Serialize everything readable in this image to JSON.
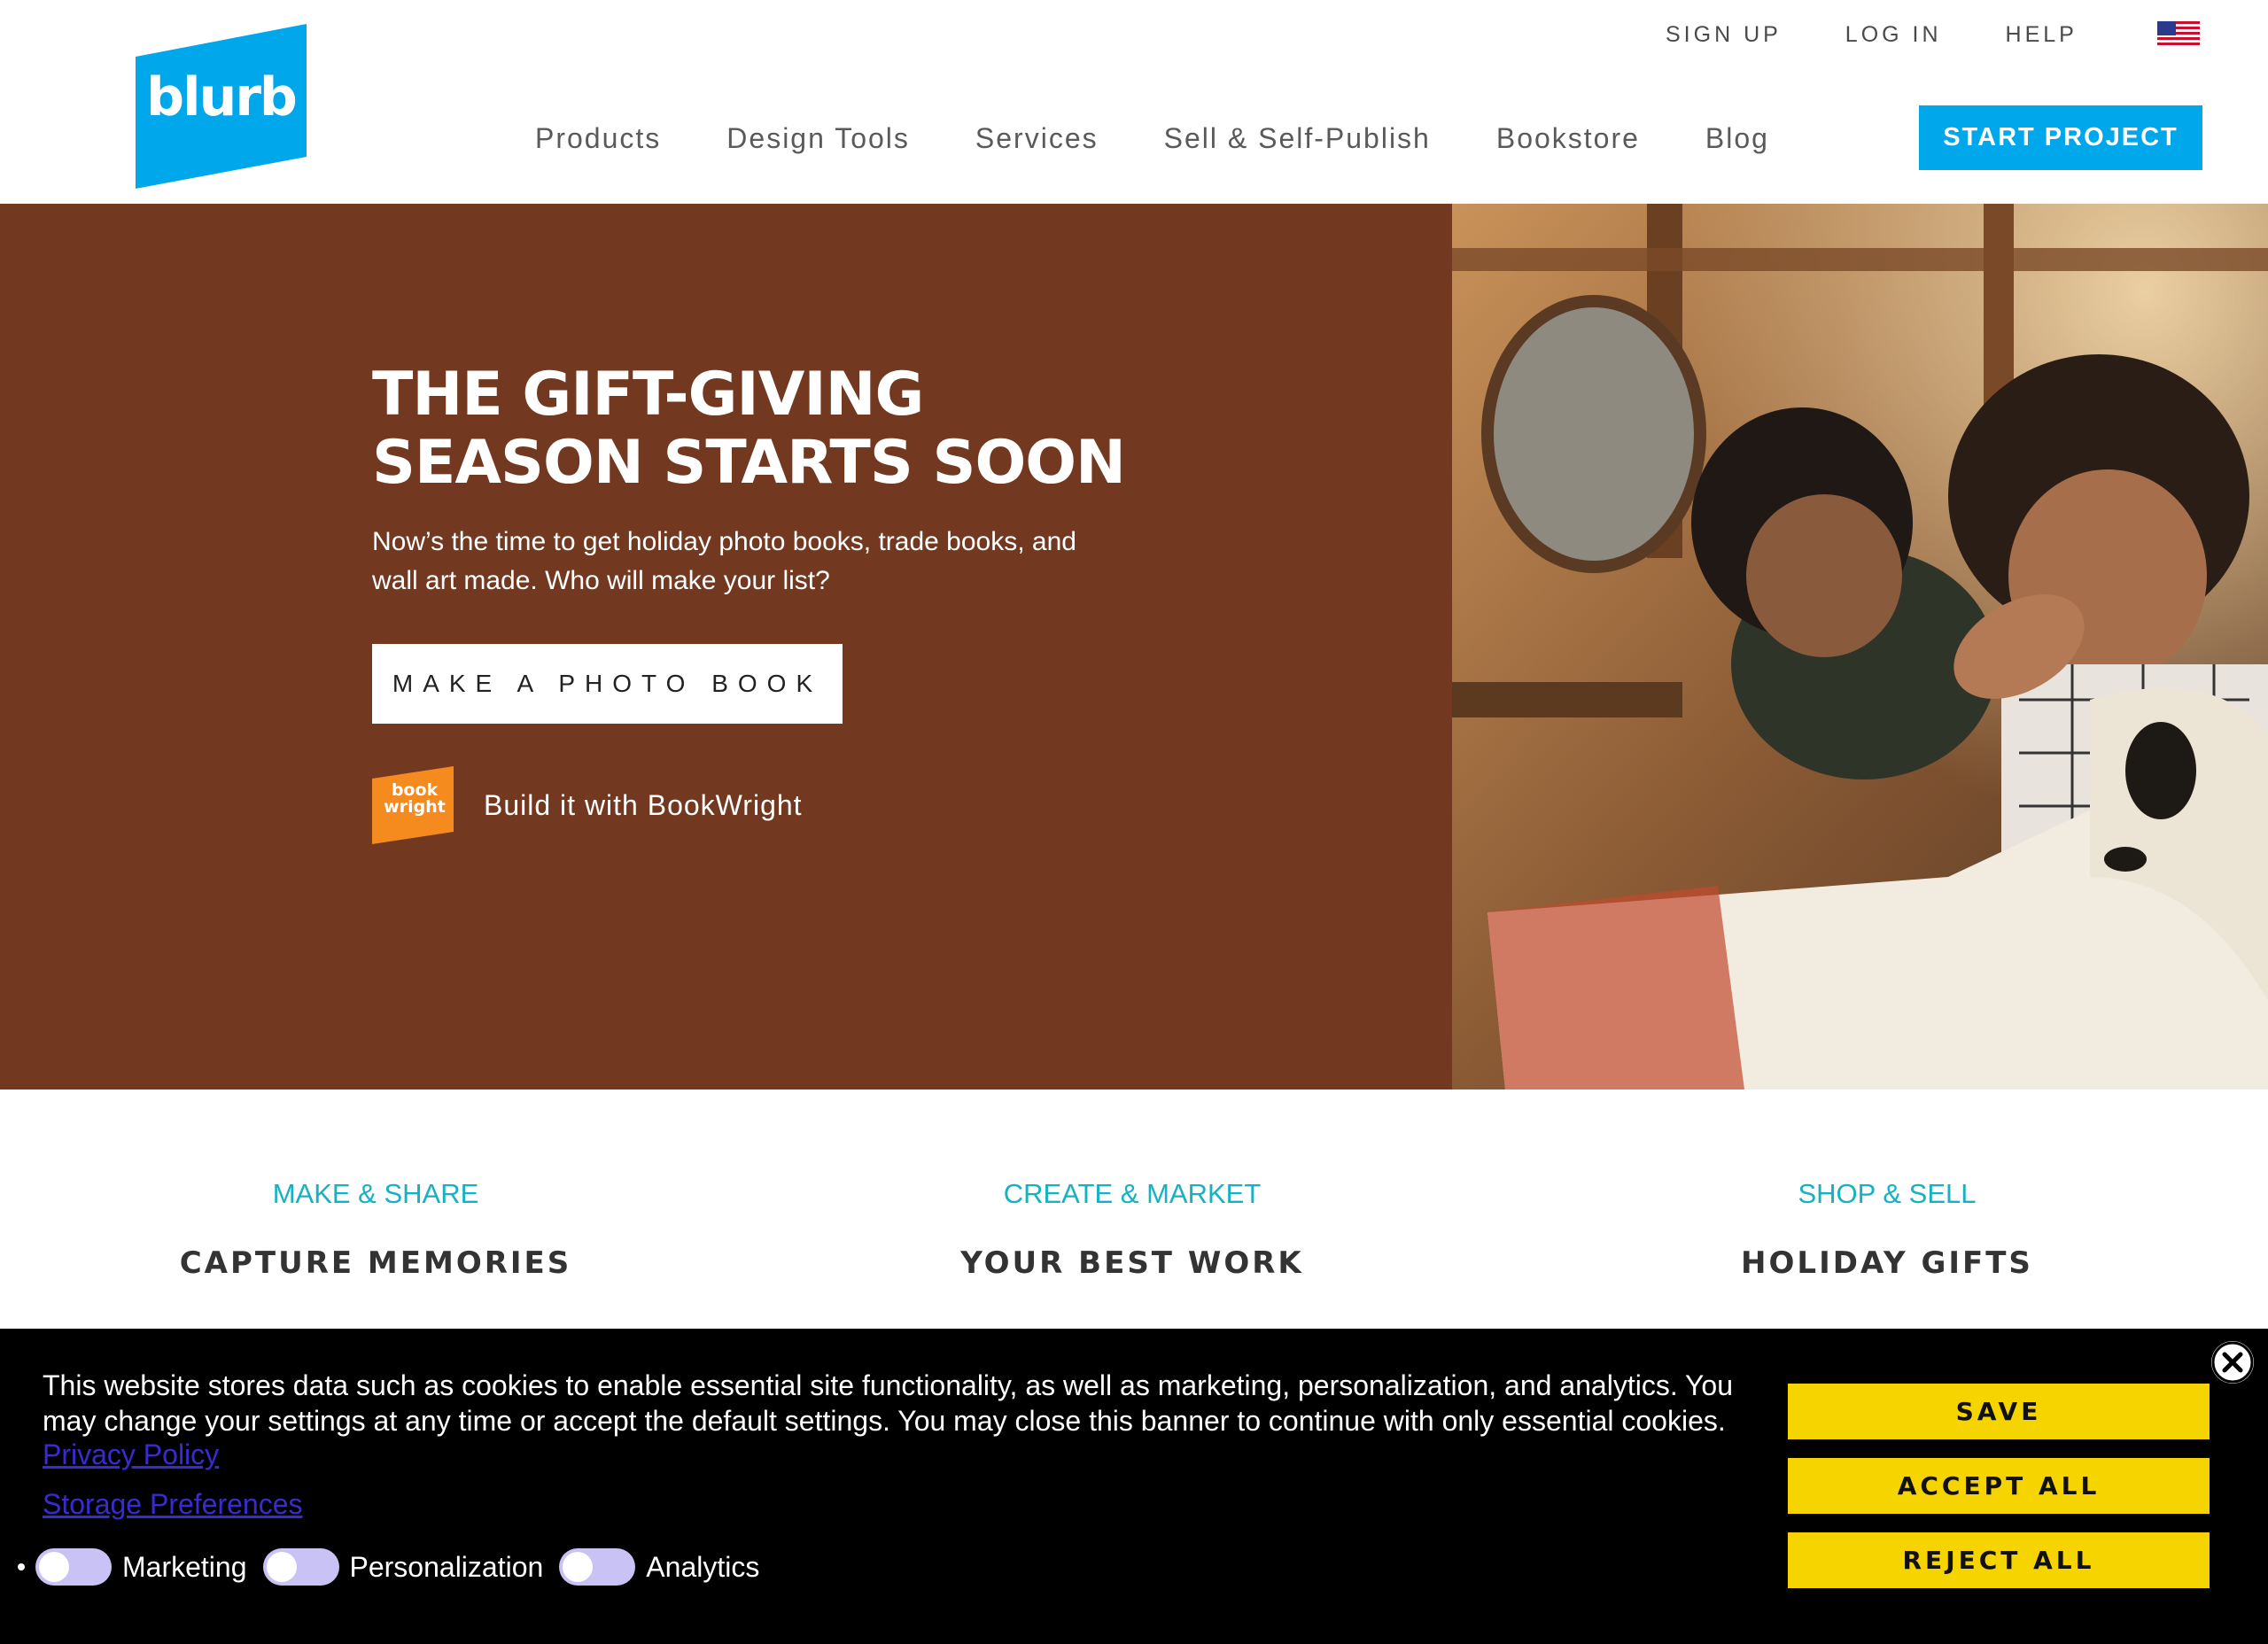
{
  "colors": {
    "brand_blue": "#00a7ea",
    "hero_brown": "#733920",
    "accent_teal": "#14b2c2",
    "cookie_yellow": "#f5d400",
    "bookwright_orange": "#f58a1f"
  },
  "header": {
    "logo_text": "blurb",
    "utility": {
      "sign_up": "SIGN UP",
      "log_in": "LOG IN",
      "help": "HELP",
      "flag_icon": "us-flag-icon"
    },
    "nav": [
      "Products",
      "Design Tools",
      "Services",
      "Sell & Self-Publish",
      "Bookstore",
      "Blog"
    ],
    "cta": "START PROJECT"
  },
  "hero": {
    "title_line1": "THE GIFT-GIVING",
    "title_line2": "SEASON STARTS SOON",
    "subtitle": "Now’s the time to get holiday photo books, trade books, and wall art made. Who will make your list?",
    "button": "MAKE A PHOTO BOOK",
    "bookwright_logo_line1": "book",
    "bookwright_logo_line2": "wright",
    "bookwright_link": "Build it with BookWright"
  },
  "categories": [
    {
      "kicker": "MAKE & SHARE",
      "title": "CAPTURE MEMORIES"
    },
    {
      "kicker": "CREATE & MARKET",
      "title": "YOUR BEST WORK"
    },
    {
      "kicker": "SHOP & SELL",
      "title": "HOLIDAY GIFTS"
    }
  ],
  "cookie": {
    "text": "This website stores data such as cookies to enable essential site functionality, as well as marketing, personalization, and analytics. You may change your settings at any time or accept the default settings. You may close this banner to continue with only essential cookies.",
    "privacy_link": "Privacy Policy",
    "storage_link": "Storage Preferences",
    "toggles": [
      "Marketing",
      "Personalization",
      "Analytics"
    ],
    "buttons": {
      "save": "SAVE",
      "accept": "ACCEPT ALL",
      "reject": "REJECT ALL"
    }
  }
}
